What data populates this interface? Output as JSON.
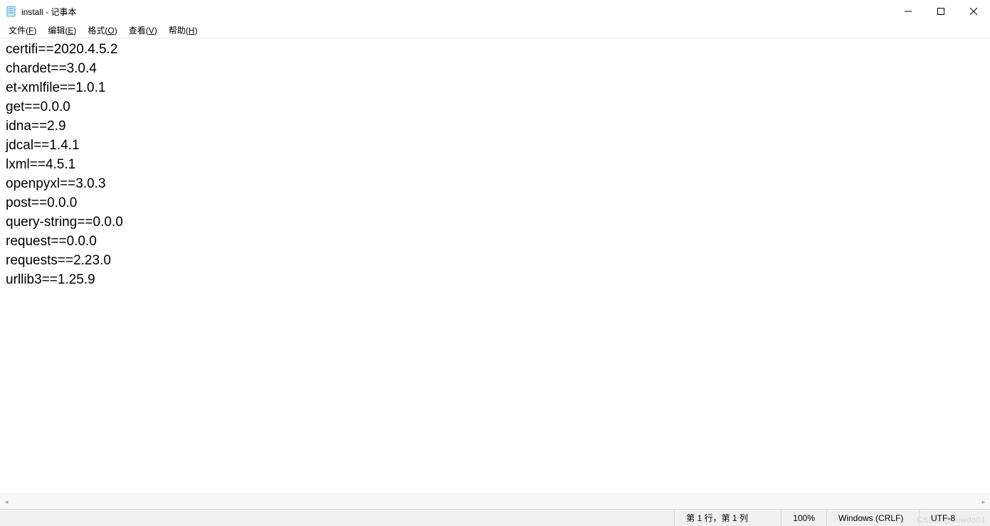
{
  "window": {
    "title": "install - 记事本"
  },
  "menu": {
    "file": {
      "label": "文件",
      "accel": "F"
    },
    "edit": {
      "label": "编辑",
      "accel": "E"
    },
    "format": {
      "label": "格式",
      "accel": "O"
    },
    "view": {
      "label": "查看",
      "accel": "V"
    },
    "help": {
      "label": "帮助",
      "accel": "H"
    }
  },
  "content": {
    "lines": [
      "certifi==2020.4.5.2",
      "chardet==3.0.4",
      "et-xmlfile==1.0.1",
      "get==0.0.0",
      "idna==2.9",
      "jdcal==1.4.1",
      "lxml==4.5.1",
      "openpyxl==3.0.3",
      "post==0.0.0",
      "query-string==0.0.0",
      "request==0.0.0",
      "requests==2.23.0",
      "urllib3==1.25.9"
    ]
  },
  "status": {
    "position": "第 1 行，第 1 列",
    "zoom": "100%",
    "line_ending": "Windows (CRLF)",
    "encoding": "UTF-8"
  },
  "watermark": "CSDN @howdo01"
}
